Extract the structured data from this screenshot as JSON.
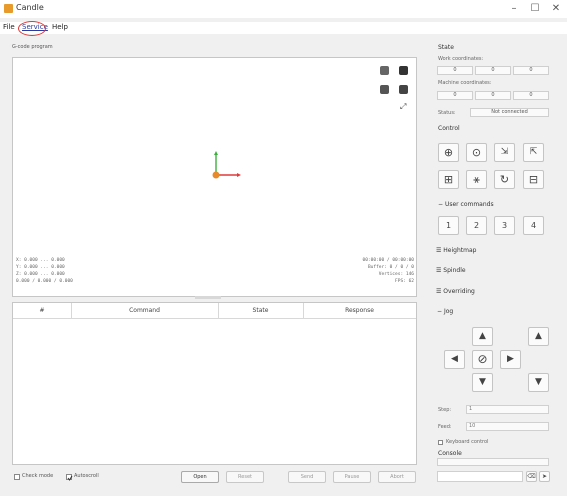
{
  "window": {
    "title": "Candle"
  },
  "menu": {
    "file": "File",
    "service": "Service",
    "help": "Help"
  },
  "gcode_label": "G-code program",
  "viewport": {
    "info_left": [
      "X: 0.000 ... 0.000",
      "Y: 0.000 ... 0.000",
      "Z: 0.000 ... 0.000",
      "0.000 / 0.000 / 0.000"
    ],
    "info_right": [
      "00:00:00 / 00:00:00",
      "Buffer: 0 / 0 / 0",
      "Vertices: 146",
      "FPS: 62"
    ]
  },
  "table": {
    "columns": [
      "#",
      "Command",
      "State",
      "Response"
    ]
  },
  "bottom": {
    "check_mode": "Check mode",
    "autoscroll": "Autoscroll",
    "buttons": [
      "Open",
      "Reset",
      "Send",
      "Pause",
      "Abort"
    ]
  },
  "state": {
    "title": "State",
    "work_label": "Work coordinates:",
    "work_values": [
      "0",
      "0",
      "0"
    ],
    "machine_label": "Machine coordinates:",
    "machine_values": [
      "0",
      "0",
      "0"
    ],
    "status_label": "Status:",
    "status_value": "Not connected"
  },
  "control": {
    "title": "Control"
  },
  "user_commands": {
    "title": "User commands",
    "buttons": [
      "1",
      "2",
      "3",
      "4"
    ]
  },
  "sections": [
    "Heightmap",
    "Spindle",
    "Overriding"
  ],
  "jog": {
    "title": "Jog",
    "step_label": "Step:",
    "step_value": "1",
    "feed_label": "Feed:",
    "feed_value": "10",
    "keyboard_control": "Keyboard control"
  },
  "console": {
    "title": "Console",
    "clear_label": "Clear"
  }
}
